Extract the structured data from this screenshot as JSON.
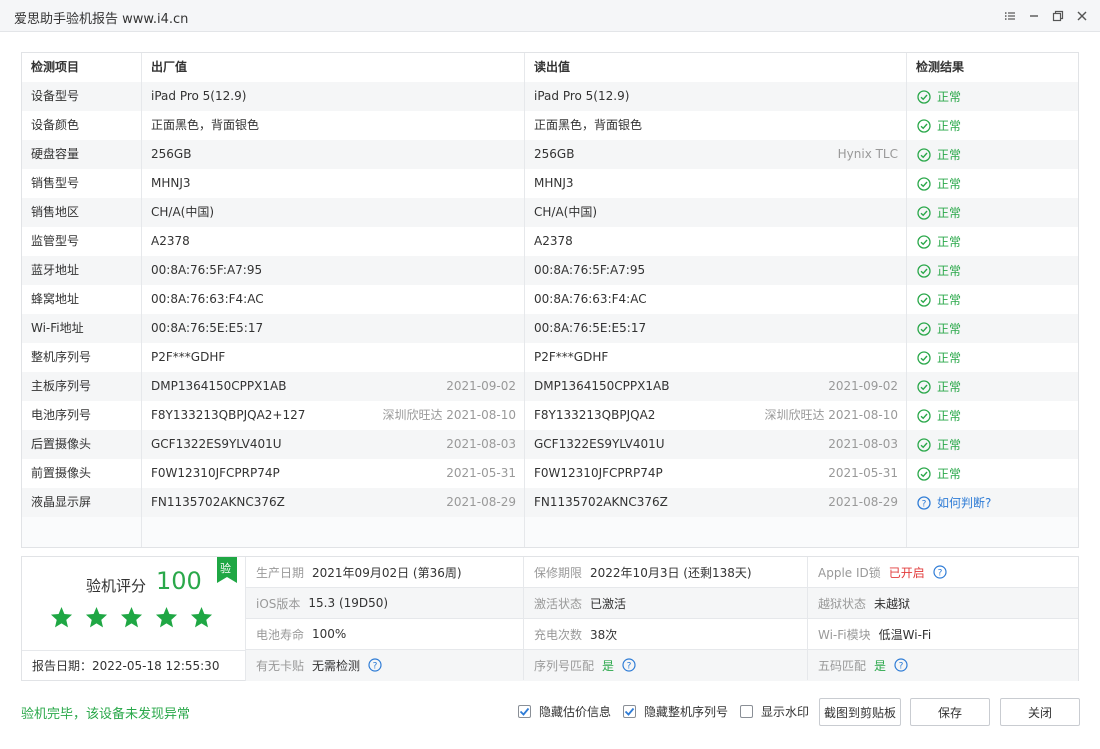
{
  "window": {
    "title": "爱思助手验机报告 www.i4.cn"
  },
  "table": {
    "headers": {
      "item": "检测项目",
      "factory": "出厂值",
      "read": "读出值",
      "result": "检测结果"
    },
    "rows": [
      {
        "item": "设备型号",
        "factory": "iPad Pro 5(12.9)",
        "factory_note": "",
        "read": "iPad Pro 5(12.9)",
        "read_note": "",
        "result": "正常",
        "status": "ok"
      },
      {
        "item": "设备颜色",
        "factory": "正面黑色，背面银色",
        "factory_note": "",
        "read": "正面黑色，背面银色",
        "read_note": "",
        "result": "正常",
        "status": "ok"
      },
      {
        "item": "硬盘容量",
        "factory": "256GB",
        "factory_note": "",
        "read": "256GB",
        "read_note": "Hynix TLC",
        "result": "正常",
        "status": "ok"
      },
      {
        "item": "销售型号",
        "factory": "MHNJ3",
        "factory_note": "",
        "read": "MHNJ3",
        "read_note": "",
        "result": "正常",
        "status": "ok"
      },
      {
        "item": "销售地区",
        "factory": "CH/A(中国)",
        "factory_note": "",
        "read": "CH/A(中国)",
        "read_note": "",
        "result": "正常",
        "status": "ok"
      },
      {
        "item": "监管型号",
        "factory": "A2378",
        "factory_note": "",
        "read": "A2378",
        "read_note": "",
        "result": "正常",
        "status": "ok"
      },
      {
        "item": "蓝牙地址",
        "factory": "00:8A:76:5F:A7:95",
        "factory_note": "",
        "read": "00:8A:76:5F:A7:95",
        "read_note": "",
        "result": "正常",
        "status": "ok"
      },
      {
        "item": "蜂窝地址",
        "factory": "00:8A:76:63:F4:AC",
        "factory_note": "",
        "read": "00:8A:76:63:F4:AC",
        "read_note": "",
        "result": "正常",
        "status": "ok"
      },
      {
        "item": "Wi-Fi地址",
        "factory": "00:8A:76:5E:E5:17",
        "factory_note": "",
        "read": "00:8A:76:5E:E5:17",
        "read_note": "",
        "result": "正常",
        "status": "ok"
      },
      {
        "item": "整机序列号",
        "factory": "P2F***GDHF",
        "factory_note": "",
        "read": "P2F***GDHF",
        "read_note": "",
        "result": "正常",
        "status": "ok"
      },
      {
        "item": "主板序列号",
        "factory": "DMP1364150CPPX1AB",
        "factory_note": "2021-09-02",
        "read": "DMP1364150CPPX1AB",
        "read_note": "2021-09-02",
        "result": "正常",
        "status": "ok"
      },
      {
        "item": "电池序列号",
        "factory": "F8Y133213QBPJQA2+127",
        "factory_note": "深圳欣旺达 2021-08-10",
        "read": "F8Y133213QBPJQA2",
        "read_note": "深圳欣旺达 2021-08-10",
        "result": "正常",
        "status": "ok"
      },
      {
        "item": "后置摄像头",
        "factory": "GCF1322ES9YLV401U",
        "factory_note": "2021-08-03",
        "read": "GCF1322ES9YLV401U",
        "read_note": "2021-08-03",
        "result": "正常",
        "status": "ok"
      },
      {
        "item": "前置摄像头",
        "factory": "F0W12310JFCPRP74P",
        "factory_note": "2021-05-31",
        "read": "F0W12310JFCPRP74P",
        "read_note": "2021-05-31",
        "result": "正常",
        "status": "ok"
      },
      {
        "item": "液晶显示屏",
        "factory": "FN1135702AKNC376Z",
        "factory_note": "2021-08-29",
        "read": "FN1135702AKNC376Z",
        "read_note": "2021-08-29",
        "result": "如何判断?",
        "status": "question"
      }
    ]
  },
  "summary": {
    "score_label": "验机评分",
    "score": "100",
    "stars": 5,
    "badge": "验",
    "report_date": "报告日期：2022-05-18 12:55:30",
    "grid": [
      [
        {
          "label": "生产日期",
          "value": "2021年09月02日 (第36周)",
          "style": "",
          "help": false
        },
        {
          "label": "保修期限",
          "value": "2022年10月3日 (还剩138天)",
          "style": "",
          "help": false
        },
        {
          "label": "Apple ID锁",
          "value": "已开启",
          "style": "red",
          "help": true
        }
      ],
      [
        {
          "label": "iOS版本",
          "value": "15.3 (19D50)",
          "style": "",
          "help": false
        },
        {
          "label": "激活状态",
          "value": "已激活",
          "style": "",
          "help": false
        },
        {
          "label": "越狱状态",
          "value": "未越狱",
          "style": "",
          "help": false
        }
      ],
      [
        {
          "label": "电池寿命",
          "value": "100%",
          "style": "",
          "help": false
        },
        {
          "label": "充电次数",
          "value": "38次",
          "style": "",
          "help": false
        },
        {
          "label": "Wi-Fi模块",
          "value": "低温Wi-Fi",
          "style": "",
          "help": false
        }
      ],
      [
        {
          "label": "有无卡贴",
          "value": "无需检测",
          "style": "",
          "help": true
        },
        {
          "label": "序列号匹配",
          "value": "是",
          "style": "green",
          "help": true
        },
        {
          "label": "五码匹配",
          "value": "是",
          "style": "green",
          "help": true
        }
      ]
    ]
  },
  "footer": {
    "status": "验机完毕，该设备未发现异常",
    "checkboxes": [
      {
        "label": "隐藏估价信息",
        "checked": true
      },
      {
        "label": "隐藏整机序列号",
        "checked": true
      },
      {
        "label": "显示水印",
        "checked": false
      }
    ],
    "buttons": {
      "copy": "截图到剪贴板",
      "save": "保存",
      "close": "关闭"
    }
  },
  "colors": {
    "ok": "#2aa84a",
    "link": "#2f7cd6",
    "danger": "#e23b3b",
    "star": "#1fa744"
  },
  "icons": [
    "list-icon",
    "minimize-icon",
    "restore-icon",
    "close-icon",
    "check-circle-icon",
    "question-circle-icon",
    "star-icon",
    "checkbox-checked-icon"
  ]
}
